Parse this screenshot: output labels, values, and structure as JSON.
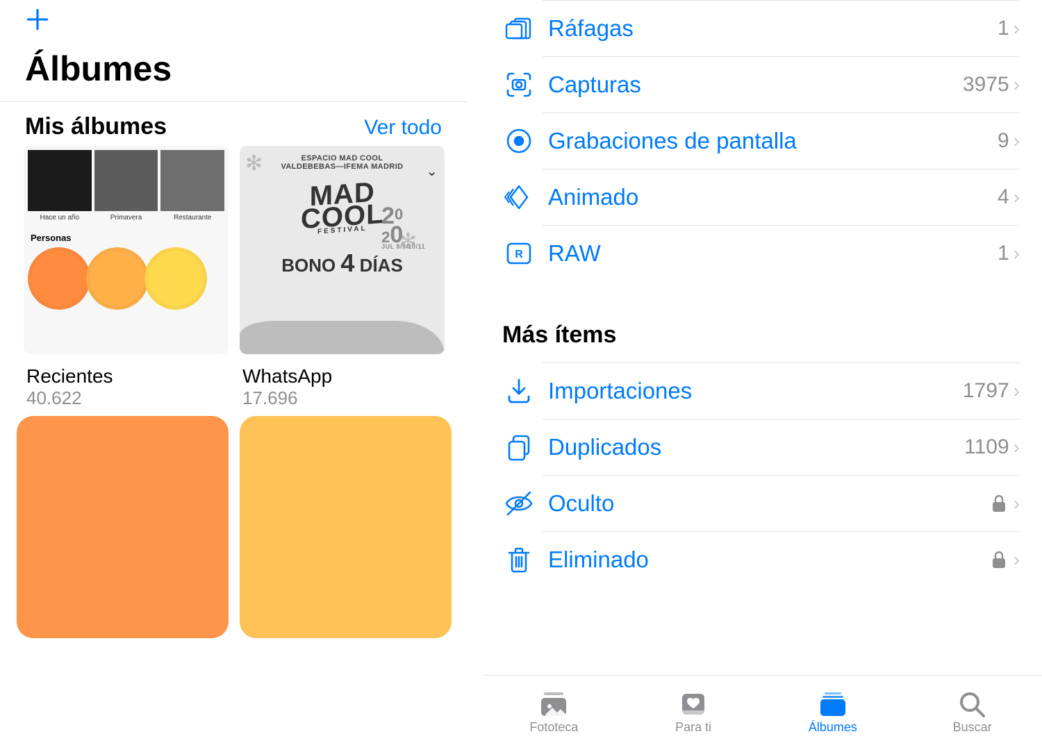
{
  "header": {
    "page_title": "Álbumes"
  },
  "my_albums": {
    "section_title": "Mis álbumes",
    "see_all": "Ver todo",
    "items": [
      {
        "title": "Recientes",
        "count": "40.622",
        "collage_labels": [
          "Hace un año",
          "Primavera",
          "Restaurante"
        ],
        "personas_label": "Personas"
      },
      {
        "title": "WhatsApp",
        "count": "17.696",
        "poster": {
          "sub1": "ESPACIO MAD COOL",
          "sub2": "VALDEBEBAS—IFEMA MADRID",
          "logo": "MAD COOL",
          "logo_sub": "FESTIVAL",
          "year": "2020",
          "dates": "JUL 8/9/10/11",
          "bono": "BONO 4 DÍAS"
        }
      }
    ]
  },
  "media_types": {
    "items": [
      {
        "icon": "burst",
        "label": "Ráfagas",
        "count": "1"
      },
      {
        "icon": "capture",
        "label": "Capturas",
        "count": "3975"
      },
      {
        "icon": "screenrec",
        "label": "Grabaciones de pantalla",
        "count": "9"
      },
      {
        "icon": "animated",
        "label": "Animado",
        "count": "4"
      },
      {
        "icon": "raw",
        "label": "RAW",
        "count": "1"
      }
    ]
  },
  "more_items": {
    "section_title": "Más ítems",
    "items": [
      {
        "icon": "import",
        "label": "Importaciones",
        "count": "1797"
      },
      {
        "icon": "duplicate",
        "label": "Duplicados",
        "count": "1109"
      },
      {
        "icon": "hidden",
        "label": "Oculto",
        "locked": true
      },
      {
        "icon": "trash",
        "label": "Eliminado",
        "locked": true
      }
    ]
  },
  "tabbar": {
    "items": [
      {
        "label": "Fototeca"
      },
      {
        "label": "Para ti"
      },
      {
        "label": "Álbumes",
        "active": true
      },
      {
        "label": "Buscar"
      }
    ]
  }
}
